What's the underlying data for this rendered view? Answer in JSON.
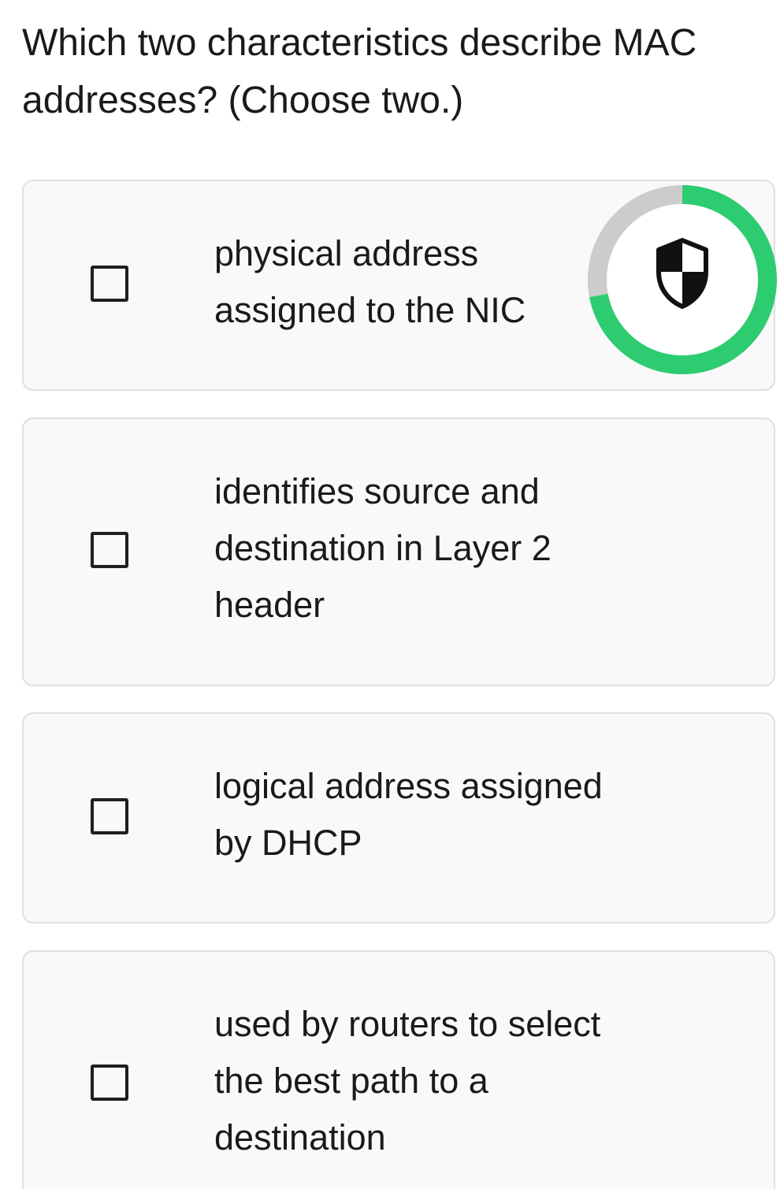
{
  "question": {
    "text": "Which two characteristics describe MAC addresses? (Choose two.)"
  },
  "options": [
    {
      "label": "physical address assigned to the NIC",
      "checked": false
    },
    {
      "label": "identifies source and destination in Layer 2 header",
      "checked": false
    },
    {
      "label": "logical address assigned by DHCP",
      "checked": false
    },
    {
      "label": "used by routers to select the best path to a destination",
      "checked": false
    }
  ],
  "security_badge": {
    "icon": "shield-icon",
    "progress": 0.72,
    "colors": {
      "progress": "#2ecc71",
      "track": "#cccccc",
      "center": "#ffffff",
      "icon": "#111111"
    }
  }
}
